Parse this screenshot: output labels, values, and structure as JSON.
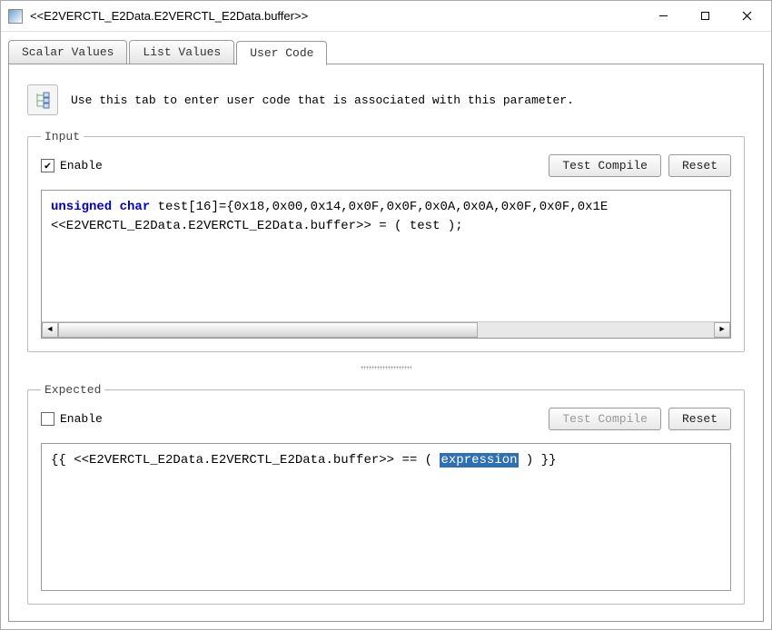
{
  "window": {
    "title": "<<E2VERCTL_E2Data.E2VERCTL_E2Data.buffer>>"
  },
  "tabs": {
    "scalar": "Scalar Values",
    "list": "List Values",
    "user": "User Code"
  },
  "info": "Use this tab to enter user code that is associated with this parameter.",
  "input": {
    "legend": "Input",
    "enable_label": "Enable",
    "enable_checked": true,
    "test_compile": "Test Compile",
    "reset": "Reset",
    "code_kw1": "unsigned",
    "code_kw2": "char",
    "code_rest1": " test[16]={0x18,0x00,0x14,0x0F,0x0F,0x0A,0x0A,0x0F,0x0F,0x1E",
    "code_line2": "<<E2VERCTL_E2Data.E2VERCTL_E2Data.buffer>> = ( test );"
  },
  "expected": {
    "legend": "Expected",
    "enable_label": "Enable",
    "enable_checked": false,
    "test_compile": "Test Compile",
    "reset": "Reset",
    "code_pre": "{{ <<E2VERCTL_E2Data.E2VERCTL_E2Data.buffer>> == ( ",
    "code_hl": "expression",
    "code_post": " ) }}"
  }
}
